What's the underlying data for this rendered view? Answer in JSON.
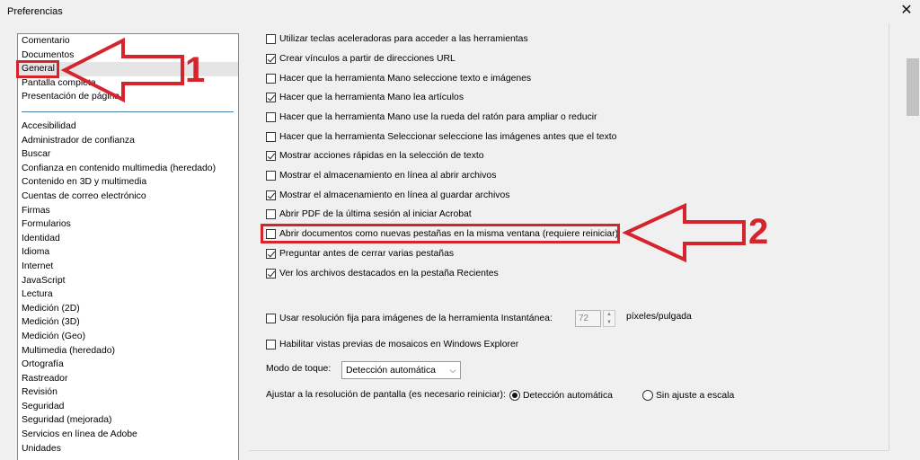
{
  "window": {
    "title": "Preferencias",
    "close_glyph": "✕"
  },
  "categories_top": [
    {
      "label": "Comentario",
      "selected": false
    },
    {
      "label": "Documentos",
      "selected": false
    },
    {
      "label": "General",
      "selected": true
    },
    {
      "label": "Pantalla completa",
      "selected": false
    },
    {
      "label": "Presentación de página",
      "selected": false
    }
  ],
  "categories_bottom": [
    "Accesibilidad",
    "Administrador de confianza",
    "Buscar",
    "Confianza en contenido multimedia (heredado)",
    "Contenido en 3D y multimedia",
    "Cuentas de correo electrónico",
    "Firmas",
    "Formularios",
    "Identidad",
    "Idioma",
    "Internet",
    "JavaScript",
    "Lectura",
    "Medición (2D)",
    "Medición (3D)",
    "Medición (Geo)",
    "Multimedia (heredado)",
    "Ortografía",
    "Rastreador",
    "Revisión",
    "Seguridad",
    "Seguridad (mejorada)",
    "Servicios en línea de Adobe",
    "Unidades"
  ],
  "options": [
    {
      "label": "Utilizar teclas aceleradoras para acceder a las herramientas",
      "checked": false
    },
    {
      "label": "Crear vínculos a partir de direcciones URL",
      "checked": true
    },
    {
      "label": "Hacer que la herramienta Mano seleccione texto e imágenes",
      "checked": false
    },
    {
      "label": "Hacer que la herramienta Mano lea artículos",
      "checked": true
    },
    {
      "label": "Hacer que la herramienta Mano use la rueda del ratón para ampliar o reducir",
      "checked": false
    },
    {
      "label": "Hacer que la herramienta Seleccionar seleccione las imágenes antes que el texto",
      "checked": false
    },
    {
      "label": "Mostrar acciones rápidas en la selección de texto",
      "checked": true
    },
    {
      "label": "Mostrar el almacenamiento en línea al abrir archivos",
      "checked": false
    },
    {
      "label": "Mostrar el almacenamiento en línea al guardar archivos",
      "checked": true
    },
    {
      "label": "Abrir PDF de la última sesión al iniciar Acrobat",
      "checked": false
    },
    {
      "label": "Abrir documentos como nuevas pestañas en la misma ventana (requiere reiniciar)",
      "checked": false
    },
    {
      "label": "Preguntar antes de cerrar varias pestañas",
      "checked": true
    },
    {
      "label": "Ver los archivos destacados en la pestaña Recientes",
      "checked": true
    }
  ],
  "snapshot": {
    "label": "Usar resolución fija para imágenes de la herramienta Instantánea:",
    "checked": false,
    "value": "72",
    "units": "píxeles/pulgada"
  },
  "thumbnails": {
    "label": "Habilitar vistas previas de mosaicos en Windows Explorer",
    "checked": false
  },
  "touch_mode": {
    "label": "Modo de toque:",
    "value": "Detección automática",
    "arrow": "⌵"
  },
  "screen_resolution": {
    "label": "Ajustar a la resolución de pantalla (es necesario reiniciar):",
    "options": [
      {
        "label": "Detección automática",
        "selected": true
      },
      {
        "label": "Sin ajuste a escala",
        "selected": false
      }
    ]
  },
  "annotations": {
    "marker_1": "1",
    "marker_2": "2",
    "color": "#d6242d"
  }
}
